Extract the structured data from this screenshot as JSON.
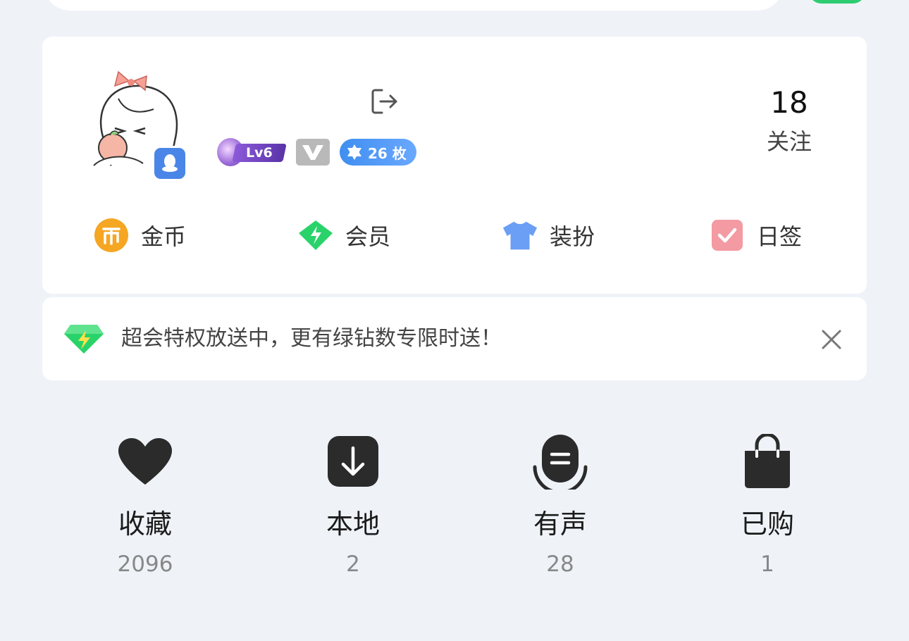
{
  "profile": {
    "level_badge": "Lv6",
    "coin_badge": "26 枚",
    "following_count": "18",
    "following_label": "关注"
  },
  "quick_links": [
    {
      "label": "金币",
      "icon": "coin-icon"
    },
    {
      "label": "会员",
      "icon": "green-diamond-icon"
    },
    {
      "label": "装扮",
      "icon": "tshirt-icon"
    },
    {
      "label": "日签",
      "icon": "checkbox-icon"
    }
  ],
  "promo": {
    "text": "超会特权放送中，更有绿钻数专限时送！",
    "icon": "green-diamond-icon"
  },
  "library": [
    {
      "label": "收藏",
      "count": "2096",
      "icon": "heart-icon"
    },
    {
      "label": "本地",
      "count": "2",
      "icon": "download-icon"
    },
    {
      "label": "有声",
      "count": "28",
      "icon": "headphones-icon"
    },
    {
      "label": "已购",
      "count": "1",
      "icon": "shopping-bag-icon"
    }
  ],
  "colors": {
    "background": "#eff3f8",
    "card": "#ffffff",
    "accent_green": "#2ecc71",
    "coin_orange": "#f5a623",
    "member_green": "#29d36a",
    "tshirt_blue": "#6b9ef5",
    "checkin_pink": "#f39aa2",
    "qq_blue": "#4a86e8"
  }
}
